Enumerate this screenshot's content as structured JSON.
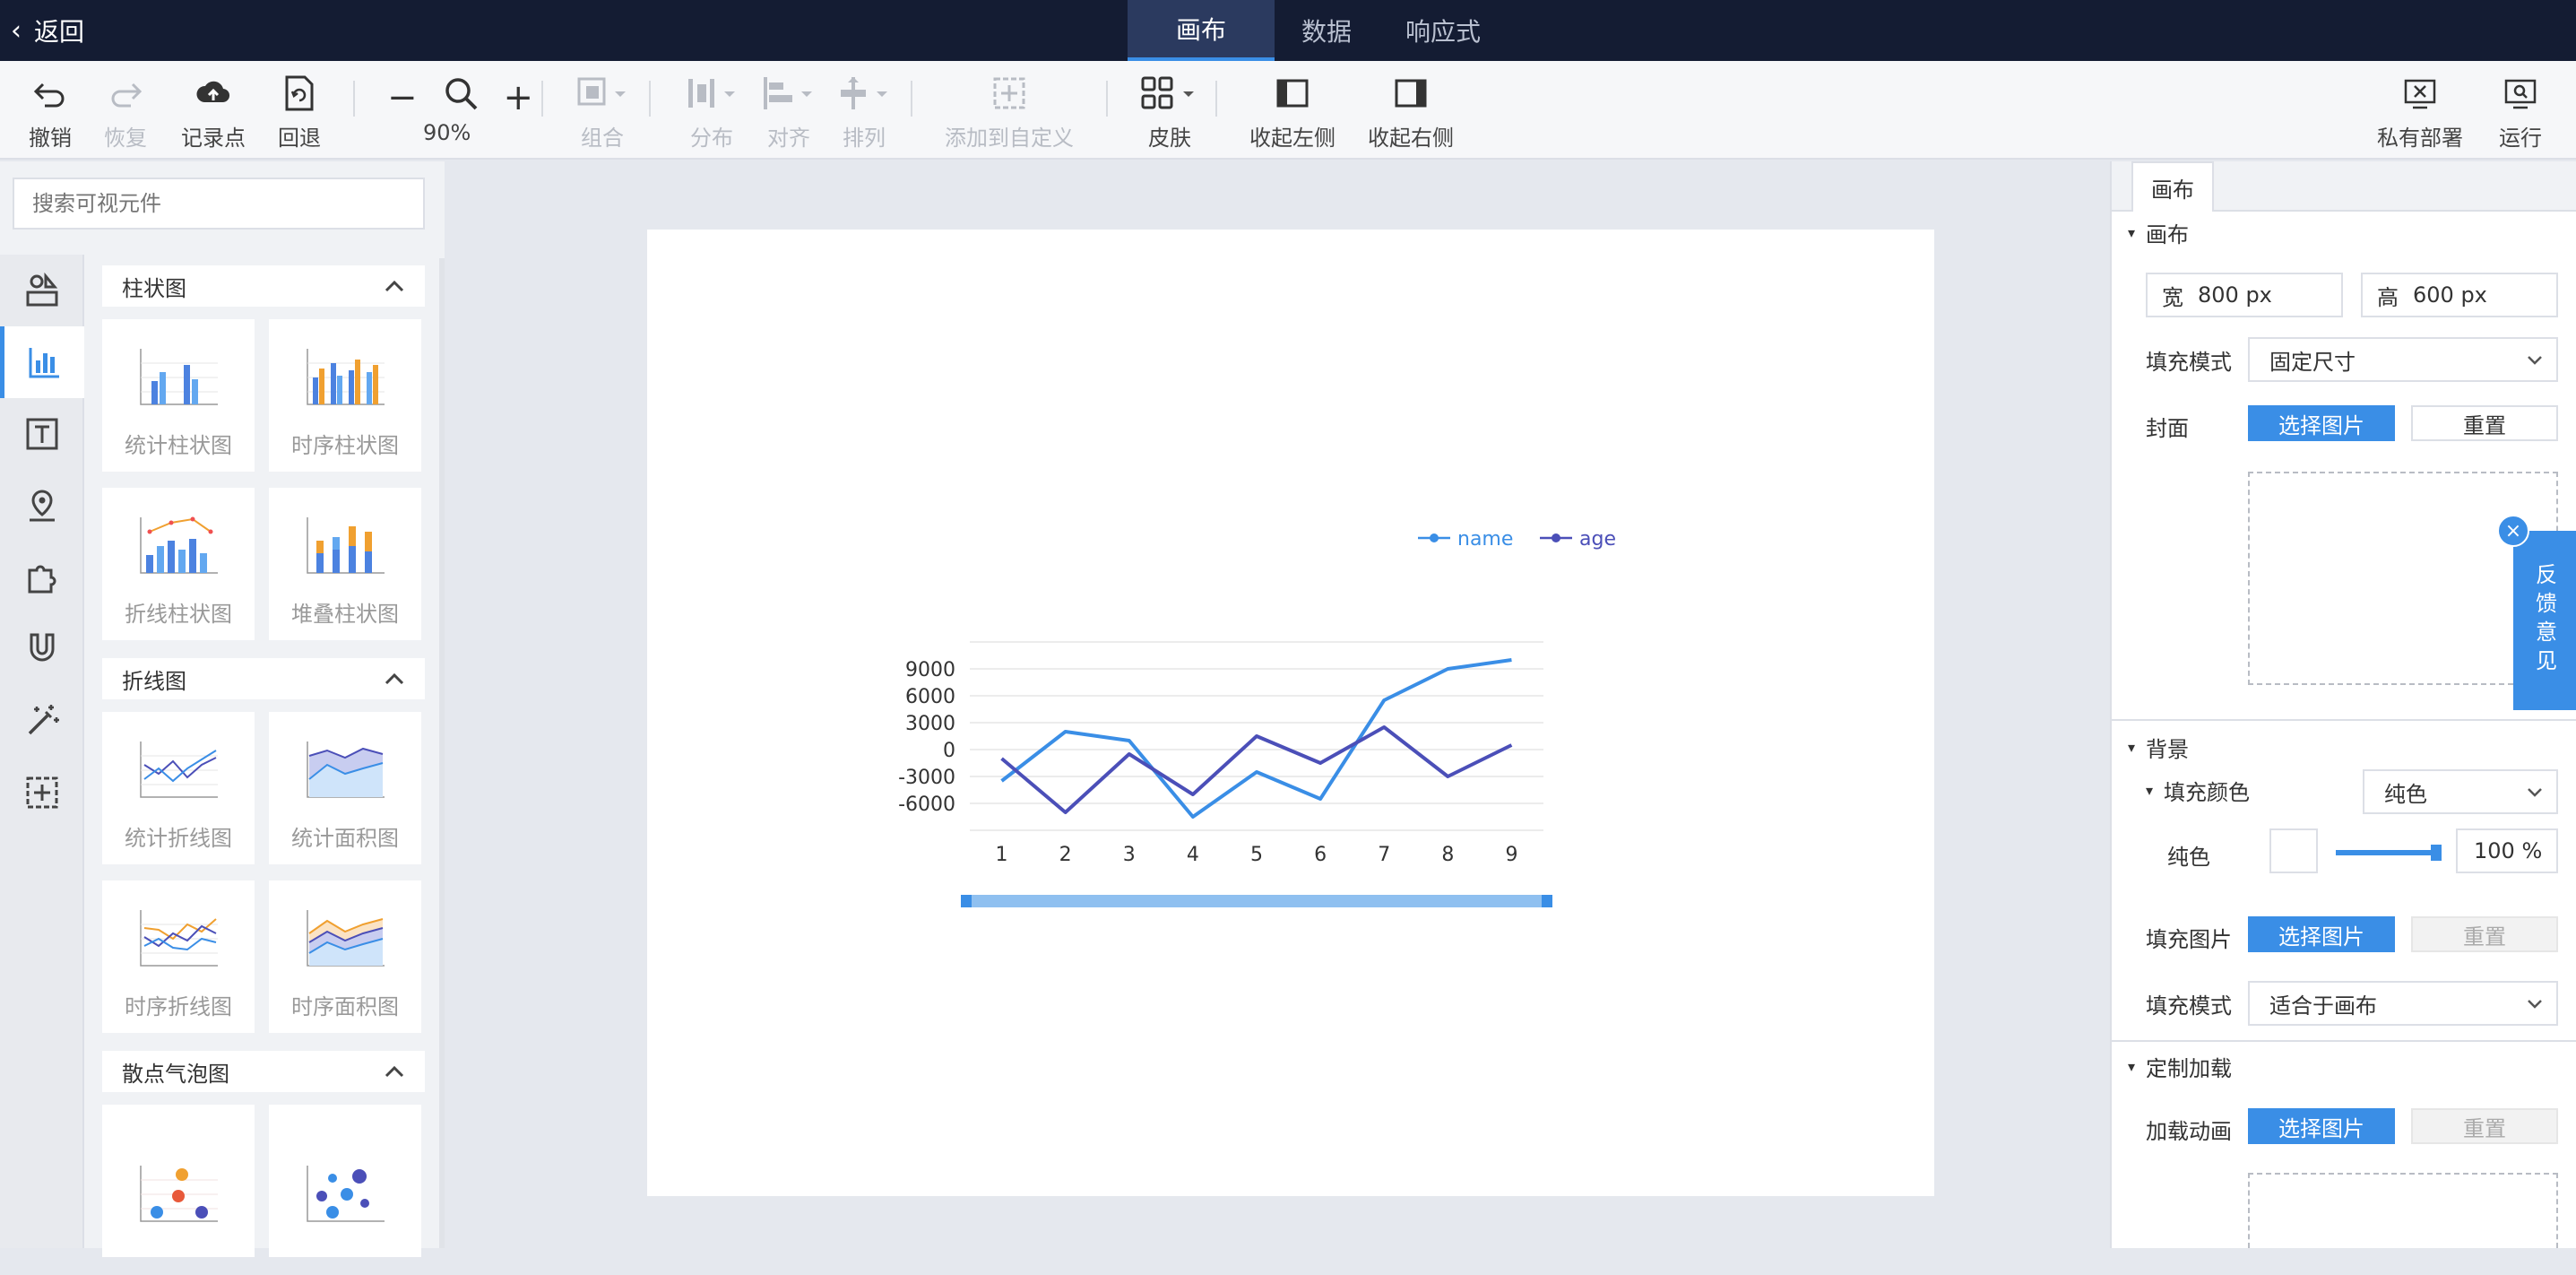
{
  "topbar": {
    "back_label": "返回",
    "tabs": [
      {
        "label": "画布",
        "active": true
      },
      {
        "label": "数据",
        "active": false
      },
      {
        "label": "响应式",
        "active": false
      }
    ]
  },
  "toolbar": {
    "undo": "撤销",
    "redo": "恢复",
    "record": "记录点",
    "revert": "回退",
    "zoom": "90%",
    "group": "组合",
    "distribute": "分布",
    "align": "对齐",
    "arrange": "排列",
    "add_custom": "添加到自定义",
    "skin": "皮肤",
    "collapse_left": "收起左侧",
    "collapse_right": "收起右侧",
    "private_deploy": "私有部署",
    "run": "运行"
  },
  "left": {
    "search_placeholder": "搜索可视元件",
    "categories": [
      {
        "title": "柱状图",
        "items": [
          "统计柱状图",
          "时序柱状图",
          "折线柱状图",
          "堆叠柱状图"
        ]
      },
      {
        "title": "折线图",
        "items": [
          "统计折线图",
          "统计面积图",
          "时序折线图",
          "时序面积图"
        ]
      },
      {
        "title": "散点气泡图",
        "items": [
          "",
          ""
        ]
      }
    ]
  },
  "right": {
    "tab": "画布",
    "canvas_section": "画布",
    "width_label": "宽",
    "width_value": "800 px",
    "height_label": "高",
    "height_value": "600 px",
    "fill_mode_label": "填充模式",
    "fill_mode_value": "固定尺寸",
    "cover_label": "封面",
    "select_image": "选择图片",
    "reset": "重置",
    "bg_section": "背景",
    "fill_color_label": "填充颜色",
    "fill_color_value": "纯色",
    "solid_label": "纯色",
    "opacity": "100 %",
    "fill_image_label": "填充图片",
    "fill_image_mode_label": "填充模式",
    "fill_image_mode_value": "适合于画布",
    "custom_load_section": "定制加载",
    "load_anim_label": "加载动画",
    "feedback": "反馈意见"
  },
  "colors": {
    "accent": "#3a8ee6",
    "topbar": "#141c33",
    "series_name": "#3a8ee6",
    "series_age": "#4b4fb8"
  },
  "chart_data": {
    "type": "line",
    "x": [
      1,
      2,
      3,
      4,
      5,
      6,
      7,
      8,
      9
    ],
    "series": [
      {
        "name": "name",
        "values": [
          -3500,
          2000,
          1000,
          -7500,
          -2500,
          -5500,
          5500,
          9000,
          10000
        ]
      },
      {
        "name": "age",
        "values": [
          -1000,
          -7000,
          -500,
          -5000,
          1500,
          -1500,
          2500,
          -3000,
          500
        ]
      }
    ],
    "yticks": [
      9000,
      6000,
      3000,
      0,
      -3000,
      -6000
    ],
    "ylim": [
      -9000,
      12000
    ],
    "legend": "top-right",
    "grid": true
  }
}
